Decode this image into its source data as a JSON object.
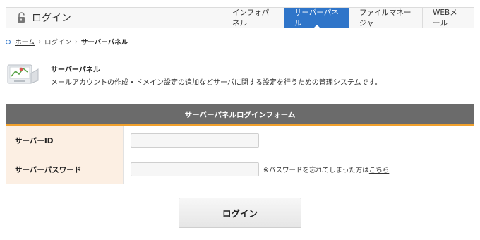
{
  "header": {
    "title": "ログイン",
    "tabs": [
      {
        "label": "インフォパネル"
      },
      {
        "label": "サーバーパネル"
      },
      {
        "label": "ファイルマネージャ"
      },
      {
        "label": "WEBメール"
      }
    ]
  },
  "breadcrumb": {
    "home": "ホーム",
    "login": "ログイン",
    "current": "サーバーパネル"
  },
  "intro": {
    "title": "サーバーパネル",
    "description": "メールアカウントの作成・ドメイン設定の追加などサーバに関する設定を行うための管理システムです。"
  },
  "form": {
    "heading": "サーバーパネルログインフォーム",
    "server_id_label": "サーバーID",
    "server_id_value": "",
    "password_label": "サーバーパスワード",
    "password_value": "",
    "forgot_text": "※パスワードを忘れてしまった方は",
    "forgot_link": "こちら",
    "submit_label": "ログイン"
  },
  "colors": {
    "accent": "#2f75c9",
    "form_header": "#6b6b6b",
    "form_header_border": "#f0a02c",
    "label_bg": "#fcefe3"
  }
}
